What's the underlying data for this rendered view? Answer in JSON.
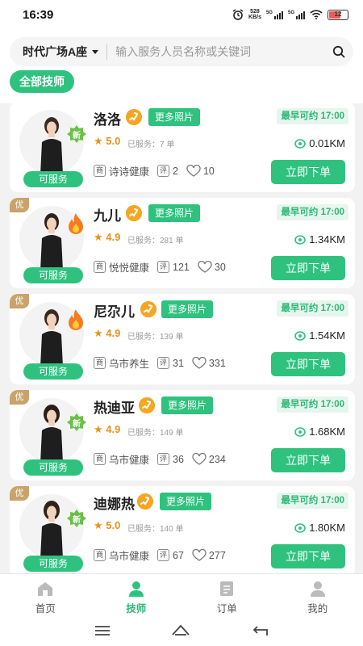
{
  "status": {
    "time": "16:39",
    "net_speed": "528",
    "net_unit": "KB/s",
    "sig1": "5G",
    "sig2": "5G",
    "battery": "12"
  },
  "header": {
    "location": "时代广场A座",
    "search_placeholder": "输入服务人员名称或关键词",
    "filter_label": "全部技师"
  },
  "cards": [
    {
      "name": "洛洛",
      "more_label": "更多照片",
      "earliest": "最早可约 17:00",
      "rating": "5.0",
      "served": "已服务：7 单",
      "distance": "0.01KM",
      "shop": "诗诗健康",
      "reviews": "2",
      "likes": "10",
      "service_label": "可服务",
      "order_label": "立即下单",
      "badge": "新",
      "you": ""
    },
    {
      "name": "九儿",
      "more_label": "更多照片",
      "earliest": "最早可约 17:00",
      "rating": "4.9",
      "served": "已服务：281 单",
      "distance": "1.34KM",
      "shop": "悦悦健康",
      "reviews": "121",
      "likes": "30",
      "service_label": "可服务",
      "order_label": "立即下单",
      "badge": "",
      "you": "优"
    },
    {
      "name": "尼尕儿",
      "more_label": "更多照片",
      "earliest": "最早可约 17:00",
      "rating": "4.9",
      "served": "已服务：139 单",
      "distance": "1.54KM",
      "shop": "乌市养生",
      "reviews": "31",
      "likes": "331",
      "service_label": "可服务",
      "order_label": "立即下单",
      "badge": "",
      "you": "优"
    },
    {
      "name": "热迪亚",
      "more_label": "更多照片",
      "earliest": "最早可约 17:00",
      "rating": "4.9",
      "served": "已服务：149 单",
      "distance": "1.68KM",
      "shop": "乌市健康",
      "reviews": "36",
      "likes": "234",
      "service_label": "可服务",
      "order_label": "立即下单",
      "badge": "新",
      "you": "优"
    },
    {
      "name": "迪娜热",
      "more_label": "更多照片",
      "earliest": "最早可约 17:00",
      "rating": "5.0",
      "served": "已服务：140 单",
      "distance": "1.80KM",
      "shop": "乌市健康",
      "reviews": "67",
      "likes": "277",
      "service_label": "可服务",
      "order_label": "立即下单",
      "badge": "新",
      "you": "优"
    }
  ],
  "meta_icons": {
    "shop": "商",
    "review": "评",
    "like": "赞"
  },
  "tabs": [
    {
      "label": "首页",
      "icon": "home-icon"
    },
    {
      "label": "技师",
      "icon": "technician-icon"
    },
    {
      "label": "订单",
      "icon": "order-icon"
    },
    {
      "label": "我的",
      "icon": "profile-icon"
    }
  ],
  "colors": {
    "accent": "#2fc27f",
    "gold": "#c9a36b",
    "orange": "#f5a623"
  }
}
